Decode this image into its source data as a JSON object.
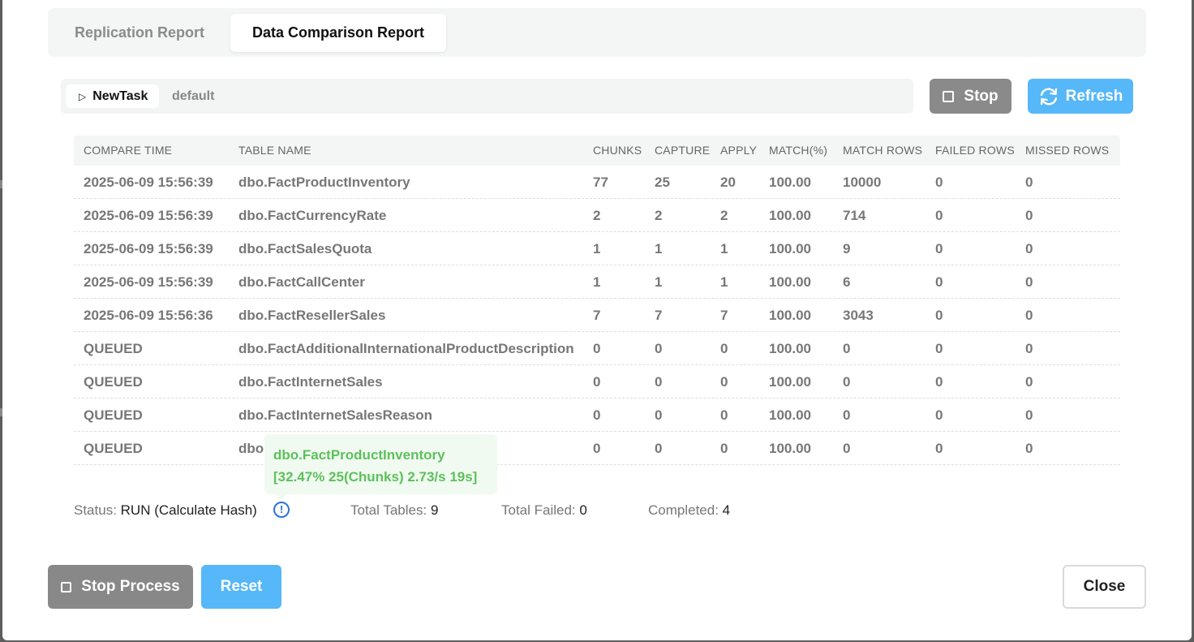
{
  "tabs": [
    {
      "label": "Replication Report",
      "active": false
    },
    {
      "label": "Data Comparison Report",
      "active": true
    }
  ],
  "task": {
    "name": "NewTask",
    "profile": "default"
  },
  "toolbar": {
    "stop_label": "Stop",
    "refresh_label": "Refresh"
  },
  "table": {
    "headers": [
      "COMPARE TIME",
      "TABLE NAME",
      "CHUNKS",
      "CAPTURE",
      "APPLY",
      "MATCH(%)",
      "MATCH ROWS",
      "FAILED ROWS",
      "MISSED ROWS"
    ],
    "rows": [
      [
        "2025-06-09 15:56:39",
        "dbo.FactProductInventory",
        "77",
        "25",
        "20",
        "100.00",
        "10000",
        "0",
        "0"
      ],
      [
        "2025-06-09 15:56:39",
        "dbo.FactCurrencyRate",
        "2",
        "2",
        "2",
        "100.00",
        "714",
        "0",
        "0"
      ],
      [
        "2025-06-09 15:56:39",
        "dbo.FactSalesQuota",
        "1",
        "1",
        "1",
        "100.00",
        "9",
        "0",
        "0"
      ],
      [
        "2025-06-09 15:56:39",
        "dbo.FactCallCenter",
        "1",
        "1",
        "1",
        "100.00",
        "6",
        "0",
        "0"
      ],
      [
        "2025-06-09 15:56:36",
        "dbo.FactResellerSales",
        "7",
        "7",
        "7",
        "100.00",
        "3043",
        "0",
        "0"
      ],
      [
        "QUEUED",
        "dbo.FactAdditionalInternationalProductDescription",
        "0",
        "0",
        "0",
        "100.00",
        "0",
        "0",
        "0"
      ],
      [
        "QUEUED",
        "dbo.FactInternetSales",
        "0",
        "0",
        "0",
        "100.00",
        "0",
        "0",
        "0"
      ],
      [
        "QUEUED",
        "dbo.FactInternetSalesReason",
        "0",
        "0",
        "0",
        "100.00",
        "0",
        "0",
        "0"
      ],
      [
        "QUEUED",
        "dbo",
        "0",
        "0",
        "0",
        "100.00",
        "0",
        "0",
        "0"
      ]
    ]
  },
  "tooltip": {
    "line1": "dbo.FactProductInventory",
    "line2": "[32.47% 25(Chunks) 2.73/s 19s]"
  },
  "status": {
    "status_label": "Status:",
    "status_value": "RUN (Calculate Hash)",
    "total_tables_label": "Total Tables:",
    "total_tables_value": "9",
    "total_failed_label": "Total Failed:",
    "total_failed_value": "0",
    "completed_label": "Completed:",
    "completed_value": "4"
  },
  "footer": {
    "stop_process_label": "Stop Process",
    "reset_label": "Reset",
    "close_label": "Close"
  },
  "colors": {
    "accent": "#56b7f9",
    "stop_gray": "#8a8a8a",
    "tooltip_green": "#5dc05d",
    "info_blue": "#2d72d9"
  }
}
